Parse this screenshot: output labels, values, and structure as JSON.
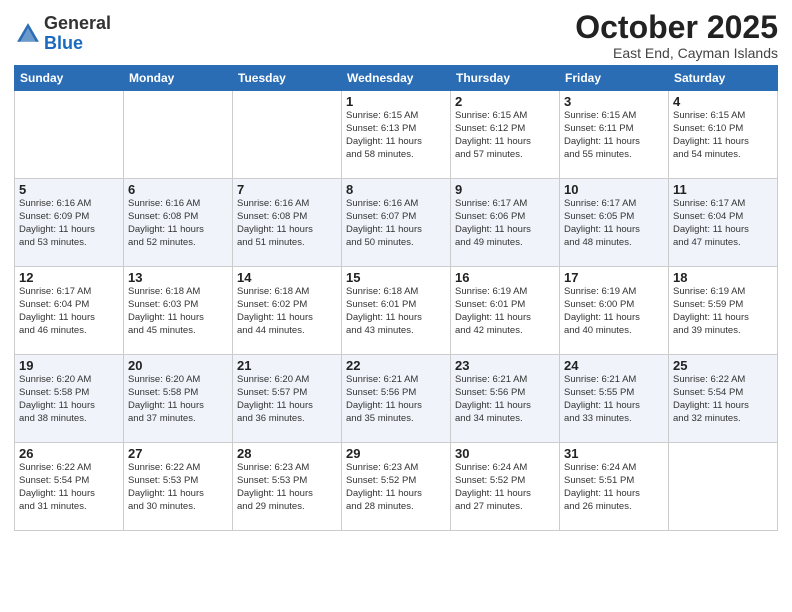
{
  "header": {
    "logo_general": "General",
    "logo_blue": "Blue",
    "month_title": "October 2025",
    "location": "East End, Cayman Islands"
  },
  "days_of_week": [
    "Sunday",
    "Monday",
    "Tuesday",
    "Wednesday",
    "Thursday",
    "Friday",
    "Saturday"
  ],
  "weeks": [
    [
      {
        "day": "",
        "info": ""
      },
      {
        "day": "",
        "info": ""
      },
      {
        "day": "",
        "info": ""
      },
      {
        "day": "1",
        "info": "Sunrise: 6:15 AM\nSunset: 6:13 PM\nDaylight: 11 hours\nand 58 minutes."
      },
      {
        "day": "2",
        "info": "Sunrise: 6:15 AM\nSunset: 6:12 PM\nDaylight: 11 hours\nand 57 minutes."
      },
      {
        "day": "3",
        "info": "Sunrise: 6:15 AM\nSunset: 6:11 PM\nDaylight: 11 hours\nand 55 minutes."
      },
      {
        "day": "4",
        "info": "Sunrise: 6:15 AM\nSunset: 6:10 PM\nDaylight: 11 hours\nand 54 minutes."
      }
    ],
    [
      {
        "day": "5",
        "info": "Sunrise: 6:16 AM\nSunset: 6:09 PM\nDaylight: 11 hours\nand 53 minutes."
      },
      {
        "day": "6",
        "info": "Sunrise: 6:16 AM\nSunset: 6:08 PM\nDaylight: 11 hours\nand 52 minutes."
      },
      {
        "day": "7",
        "info": "Sunrise: 6:16 AM\nSunset: 6:08 PM\nDaylight: 11 hours\nand 51 minutes."
      },
      {
        "day": "8",
        "info": "Sunrise: 6:16 AM\nSunset: 6:07 PM\nDaylight: 11 hours\nand 50 minutes."
      },
      {
        "day": "9",
        "info": "Sunrise: 6:17 AM\nSunset: 6:06 PM\nDaylight: 11 hours\nand 49 minutes."
      },
      {
        "day": "10",
        "info": "Sunrise: 6:17 AM\nSunset: 6:05 PM\nDaylight: 11 hours\nand 48 minutes."
      },
      {
        "day": "11",
        "info": "Sunrise: 6:17 AM\nSunset: 6:04 PM\nDaylight: 11 hours\nand 47 minutes."
      }
    ],
    [
      {
        "day": "12",
        "info": "Sunrise: 6:17 AM\nSunset: 6:04 PM\nDaylight: 11 hours\nand 46 minutes."
      },
      {
        "day": "13",
        "info": "Sunrise: 6:18 AM\nSunset: 6:03 PM\nDaylight: 11 hours\nand 45 minutes."
      },
      {
        "day": "14",
        "info": "Sunrise: 6:18 AM\nSunset: 6:02 PM\nDaylight: 11 hours\nand 44 minutes."
      },
      {
        "day": "15",
        "info": "Sunrise: 6:18 AM\nSunset: 6:01 PM\nDaylight: 11 hours\nand 43 minutes."
      },
      {
        "day": "16",
        "info": "Sunrise: 6:19 AM\nSunset: 6:01 PM\nDaylight: 11 hours\nand 42 minutes."
      },
      {
        "day": "17",
        "info": "Sunrise: 6:19 AM\nSunset: 6:00 PM\nDaylight: 11 hours\nand 40 minutes."
      },
      {
        "day": "18",
        "info": "Sunrise: 6:19 AM\nSunset: 5:59 PM\nDaylight: 11 hours\nand 39 minutes."
      }
    ],
    [
      {
        "day": "19",
        "info": "Sunrise: 6:20 AM\nSunset: 5:58 PM\nDaylight: 11 hours\nand 38 minutes."
      },
      {
        "day": "20",
        "info": "Sunrise: 6:20 AM\nSunset: 5:58 PM\nDaylight: 11 hours\nand 37 minutes."
      },
      {
        "day": "21",
        "info": "Sunrise: 6:20 AM\nSunset: 5:57 PM\nDaylight: 11 hours\nand 36 minutes."
      },
      {
        "day": "22",
        "info": "Sunrise: 6:21 AM\nSunset: 5:56 PM\nDaylight: 11 hours\nand 35 minutes."
      },
      {
        "day": "23",
        "info": "Sunrise: 6:21 AM\nSunset: 5:56 PM\nDaylight: 11 hours\nand 34 minutes."
      },
      {
        "day": "24",
        "info": "Sunrise: 6:21 AM\nSunset: 5:55 PM\nDaylight: 11 hours\nand 33 minutes."
      },
      {
        "day": "25",
        "info": "Sunrise: 6:22 AM\nSunset: 5:54 PM\nDaylight: 11 hours\nand 32 minutes."
      }
    ],
    [
      {
        "day": "26",
        "info": "Sunrise: 6:22 AM\nSunset: 5:54 PM\nDaylight: 11 hours\nand 31 minutes."
      },
      {
        "day": "27",
        "info": "Sunrise: 6:22 AM\nSunset: 5:53 PM\nDaylight: 11 hours\nand 30 minutes."
      },
      {
        "day": "28",
        "info": "Sunrise: 6:23 AM\nSunset: 5:53 PM\nDaylight: 11 hours\nand 29 minutes."
      },
      {
        "day": "29",
        "info": "Sunrise: 6:23 AM\nSunset: 5:52 PM\nDaylight: 11 hours\nand 28 minutes."
      },
      {
        "day": "30",
        "info": "Sunrise: 6:24 AM\nSunset: 5:52 PM\nDaylight: 11 hours\nand 27 minutes."
      },
      {
        "day": "31",
        "info": "Sunrise: 6:24 AM\nSunset: 5:51 PM\nDaylight: 11 hours\nand 26 minutes."
      },
      {
        "day": "",
        "info": ""
      }
    ]
  ]
}
